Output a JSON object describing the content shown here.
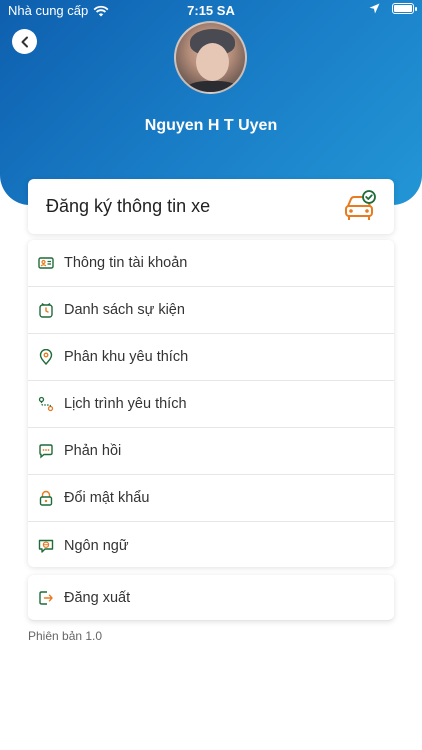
{
  "status_bar": {
    "carrier": "Nhà cung cấp",
    "time": "7:15 SA"
  },
  "profile": {
    "name": "Nguyen H T Uyen"
  },
  "vehicle_card": {
    "title": "Đăng ký thông tin xe",
    "icon": "car-check-icon"
  },
  "menu": {
    "items": [
      {
        "label": "Thông tin tài khoản",
        "icon": "id-card-icon"
      },
      {
        "label": "Danh sách sự kiện",
        "icon": "alarm-clock-icon"
      },
      {
        "label": "Phân khu yêu thích",
        "icon": "location-pin-icon"
      },
      {
        "label": "Lịch trình yêu thích",
        "icon": "route-icon"
      },
      {
        "label": "Phản hồi",
        "icon": "feedback-icon"
      },
      {
        "label": "Đổi mật khẩu",
        "icon": "lock-icon"
      },
      {
        "label": "Ngôn ngữ",
        "icon": "language-icon"
      }
    ],
    "logout_label": "Đăng xuất"
  },
  "version": "Phiên bản 1.0",
  "colors": {
    "header_start": "#0e5fae",
    "header_end": "#2396d6",
    "icon_green": "#1f6b3a",
    "icon_orange": "#e87b1e"
  }
}
